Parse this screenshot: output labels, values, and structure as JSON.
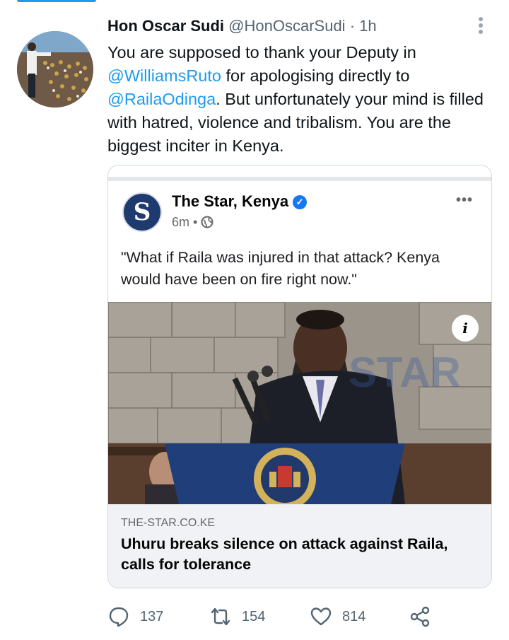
{
  "tweet": {
    "author_name": "Hon Oscar Sudi",
    "handle": "@HonOscarSudi",
    "separator": "·",
    "time": "1h",
    "text_parts": {
      "p1": "You are supposed to thank your Deputy in ",
      "mention1": "@WilliamsRuto",
      "p2": " for apologising directly to ",
      "mention2": "@RailaOdinga",
      "p3": ". But unfortunately your mind is filled with hatred, violence and tribalism. You are the biggest inciter in Kenya."
    },
    "more_icon": "more-vertical-icon"
  },
  "embedded_post": {
    "page_name": "The Star, Kenya",
    "logo_letter": "S",
    "time": "6m",
    "dot": "•",
    "privacy_icon": "globe-icon",
    "more_icon": "more-horizontal-icon",
    "quote": "\"What if Raila was injured in that attack? Kenya would have been on fire right now.\"",
    "info_icon": "i",
    "link_domain": "THE-STAR.CO.KE",
    "link_title": "Uhuru breaks silence on attack against Raila, calls for tolerance"
  },
  "actions": {
    "replies": "137",
    "retweets": "154",
    "likes": "814",
    "reply_icon": "reply-icon",
    "retweet_icon": "retweet-icon",
    "like_icon": "heart-icon",
    "share_icon": "share-icon"
  },
  "colors": {
    "accent": "#1d9bf0",
    "text": "#0f1419",
    "muted": "#536471",
    "fb_blue": "#1877f2"
  }
}
